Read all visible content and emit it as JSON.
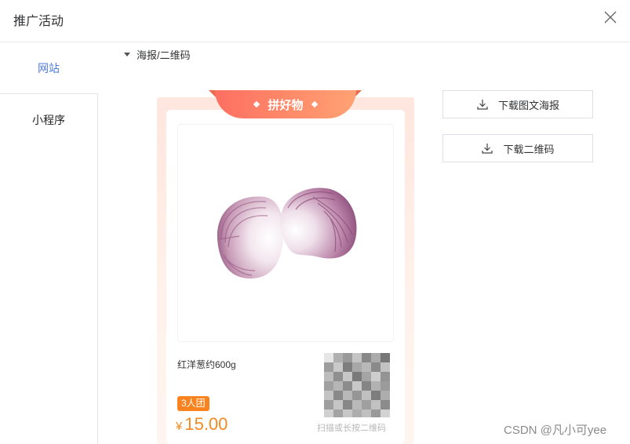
{
  "dialog": {
    "title": "推广活动",
    "close_icon": "close-icon"
  },
  "sidebar": {
    "items": [
      {
        "label": "网站",
        "active": true
      },
      {
        "label": "小程序",
        "active": false
      }
    ]
  },
  "section": {
    "label": "海报/二维码",
    "icon": "caret-down-icon"
  },
  "poster": {
    "ribbon": "拼好物",
    "product_name": "红洋葱约600g",
    "group_badge": "3人团",
    "currency": "¥",
    "price": "15.00",
    "qr_tip": "扫描或长按二维码",
    "image": "red-onion-image"
  },
  "actions": {
    "download_poster": "下载图文海报",
    "download_qr": "下载二维码",
    "icon": "download-icon"
  },
  "watermark": "CSDN @凡小可yee",
  "colors": {
    "accent": "#4e7bd9",
    "ribbon": "#ff7a66",
    "price": "#f28a1f",
    "badge": "#f9831f"
  }
}
